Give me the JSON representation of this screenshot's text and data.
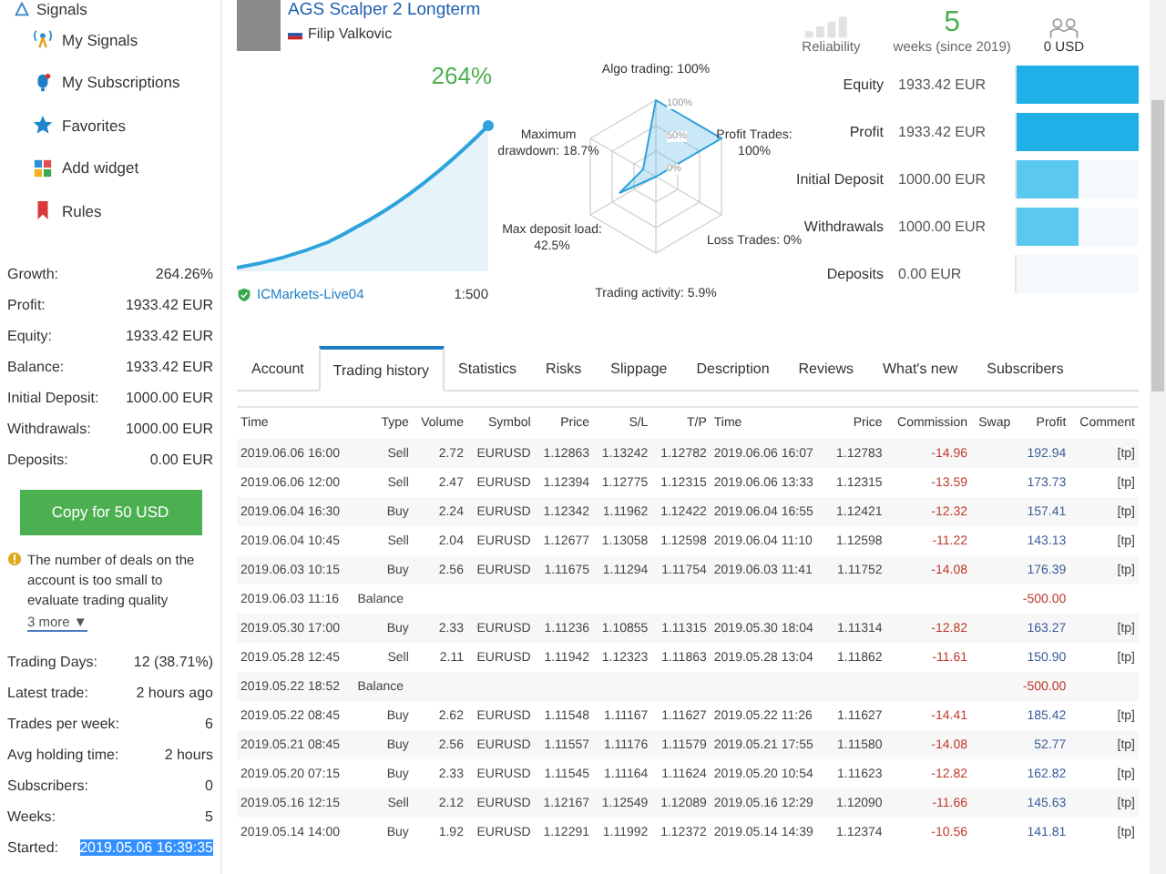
{
  "sidebar": {
    "title": "Signals",
    "menu": [
      {
        "label": "My Signals"
      },
      {
        "label": "My Subscriptions"
      },
      {
        "label": "Favorites"
      },
      {
        "label": "Add widget"
      },
      {
        "label": "Rules"
      }
    ],
    "summary": [
      {
        "label": "Growth:",
        "value": "264.26%"
      },
      {
        "label": "Profit:",
        "value": "1933.42 EUR"
      },
      {
        "label": "Equity:",
        "value": "1933.42 EUR"
      },
      {
        "label": "Balance:",
        "value": "1933.42 EUR"
      },
      {
        "label": "Initial Deposit:",
        "value": "1000.00 EUR"
      },
      {
        "label": "Withdrawals:",
        "value": "1000.00 EUR"
      },
      {
        "label": "Deposits:",
        "value": "0.00 EUR"
      }
    ],
    "copy_button": "Copy for 50 USD",
    "warning": "The number of deals on the account is too small to evaluate trading quality",
    "more_link": "3 more ▼",
    "details": [
      {
        "label": "Trading Days:",
        "value": "12 (38.71%)",
        "highlighted": false
      },
      {
        "label": "Latest trade:",
        "value": "2 hours ago",
        "highlighted": false
      },
      {
        "label": "Trades per week:",
        "value": "6",
        "highlighted": false
      },
      {
        "label": "Avg holding time:",
        "value": "2 hours",
        "highlighted": false
      },
      {
        "label": "Subscribers:",
        "value": "0",
        "highlighted": false
      },
      {
        "label": "Weeks:",
        "value": "5",
        "highlighted": false
      },
      {
        "label": "Started:",
        "value": "2019.05.06 16:39:35",
        "highlighted": true
      }
    ]
  },
  "header": {
    "title": "AGS Scalper 2 Longterm",
    "author": "Filip Valkovic",
    "reliability": "Reliability",
    "weeks": "5",
    "weeks_label": "weeks (since 2019)",
    "subscribers_cost": "0 USD"
  },
  "growth": {
    "value": "264%",
    "broker": "ICMarkets-Live04",
    "leverage": "1:500"
  },
  "radar": {
    "ticks": [
      "100%",
      "50%",
      "0%"
    ],
    "labels": [
      "Algo trading: 100%",
      "Maximum drawdown: 18.7%",
      "Profit Trades: 100%",
      "Max deposit load: 42.5%",
      "Loss Trades: 0%",
      "Trading activity: 5.9%"
    ]
  },
  "balance_bars": [
    {
      "label": "Equity",
      "value": "1933.42 EUR",
      "level": 1.0
    },
    {
      "label": "Profit",
      "value": "1933.42 EUR",
      "level": 1.0
    },
    {
      "label": "Initial Deposit",
      "value": "1000.00 EUR",
      "level": 0.52
    },
    {
      "label": "Withdrawals",
      "value": "1000.00 EUR",
      "level": 0.52
    },
    {
      "label": "Deposits",
      "value": "0.00 EUR",
      "level": 0
    }
  ],
  "tabs": [
    {
      "label": "Account",
      "selected": false
    },
    {
      "label": "Trading history",
      "selected": true
    },
    {
      "label": "Statistics",
      "selected": false
    },
    {
      "label": "Risks",
      "selected": false
    },
    {
      "label": "Slippage",
      "selected": false
    },
    {
      "label": "Description",
      "selected": false
    },
    {
      "label": "Reviews",
      "selected": false
    },
    {
      "label": "What's new",
      "selected": false
    },
    {
      "label": "Subscribers",
      "selected": false
    }
  ],
  "table": {
    "columns": [
      "Time",
      "Type",
      "Volume",
      "Symbol",
      "Price",
      "S/L",
      "T/P",
      "Time",
      "Price",
      "Commission",
      "Swap",
      "Profit",
      "Comment"
    ],
    "rows": [
      {
        "kind": "trade",
        "cells": [
          "2019.06.06 16:00",
          "Sell",
          "2.72",
          "EURUSD",
          "1.12863",
          "1.13242",
          "1.12782",
          "2019.06.06 16:07",
          "1.12783",
          "-14.96",
          "",
          "192.94",
          "[tp]"
        ]
      },
      {
        "kind": "trade",
        "cells": [
          "2019.06.06 12:00",
          "Sell",
          "2.47",
          "EURUSD",
          "1.12394",
          "1.12775",
          "1.12315",
          "2019.06.06 13:33",
          "1.12315",
          "-13.59",
          "",
          "173.73",
          "[tp]"
        ]
      },
      {
        "kind": "trade",
        "cells": [
          "2019.06.04 16:30",
          "Buy",
          "2.24",
          "EURUSD",
          "1.12342",
          "1.11962",
          "1.12422",
          "2019.06.04 16:55",
          "1.12421",
          "-12.32",
          "",
          "157.41",
          "[tp]"
        ]
      },
      {
        "kind": "trade",
        "cells": [
          "2019.06.04 10:45",
          "Sell",
          "2.04",
          "EURUSD",
          "1.12677",
          "1.13058",
          "1.12598",
          "2019.06.04 11:10",
          "1.12598",
          "-11.22",
          "",
          "143.13",
          "[tp]"
        ]
      },
      {
        "kind": "trade",
        "cells": [
          "2019.06.03 10:15",
          "Buy",
          "2.56",
          "EURUSD",
          "1.11675",
          "1.11294",
          "1.11754",
          "2019.06.03 11:41",
          "1.11752",
          "-14.08",
          "",
          "176.39",
          "[tp]"
        ]
      },
      {
        "kind": "balance",
        "cells": [
          "2019.06.03 11:16",
          "Balance",
          "",
          "",
          "",
          "",
          "",
          "",
          "",
          "",
          "",
          "-500.00",
          ""
        ]
      },
      {
        "kind": "trade",
        "cells": [
          "2019.05.30 17:00",
          "Buy",
          "2.33",
          "EURUSD",
          "1.11236",
          "1.10855",
          "1.11315",
          "2019.05.30 18:04",
          "1.11314",
          "-12.82",
          "",
          "163.27",
          "[tp]"
        ]
      },
      {
        "kind": "trade",
        "cells": [
          "2019.05.28 12:45",
          "Sell",
          "2.11",
          "EURUSD",
          "1.11942",
          "1.12323",
          "1.11863",
          "2019.05.28 13:04",
          "1.11862",
          "-11.61",
          "",
          "150.90",
          "[tp]"
        ]
      },
      {
        "kind": "balance",
        "cells": [
          "2019.05.22 18:52",
          "Balance",
          "",
          "",
          "",
          "",
          "",
          "",
          "",
          "",
          "",
          "-500.00",
          ""
        ]
      },
      {
        "kind": "trade",
        "cells": [
          "2019.05.22 08:45",
          "Buy",
          "2.62",
          "EURUSD",
          "1.11548",
          "1.11167",
          "1.11627",
          "2019.05.22 11:26",
          "1.11627",
          "-14.41",
          "",
          "185.42",
          "[tp]"
        ]
      },
      {
        "kind": "trade",
        "cells": [
          "2019.05.21 08:45",
          "Buy",
          "2.56",
          "EURUSD",
          "1.11557",
          "1.11176",
          "1.11579",
          "2019.05.21 17:55",
          "1.11580",
          "-14.08",
          "",
          "52.77",
          "[tp]"
        ]
      },
      {
        "kind": "trade",
        "cells": [
          "2019.05.20 07:15",
          "Buy",
          "2.33",
          "EURUSD",
          "1.11545",
          "1.11164",
          "1.11624",
          "2019.05.20 10:54",
          "1.11623",
          "-12.82",
          "",
          "162.82",
          "[tp]"
        ]
      },
      {
        "kind": "trade",
        "cells": [
          "2019.05.16 12:15",
          "Sell",
          "2.12",
          "EURUSD",
          "1.12167",
          "1.12549",
          "1.12089",
          "2019.05.16 12:29",
          "1.12090",
          "-11.66",
          "",
          "145.63",
          "[tp]"
        ]
      },
      {
        "kind": "trade",
        "cells": [
          "2019.05.14 14:00",
          "Buy",
          "1.92",
          "EURUSD",
          "1.12291",
          "1.11992",
          "1.12372",
          "2019.05.14 14:39",
          "1.12374",
          "-10.56",
          "",
          "141.81",
          "[tp]"
        ]
      }
    ]
  }
}
